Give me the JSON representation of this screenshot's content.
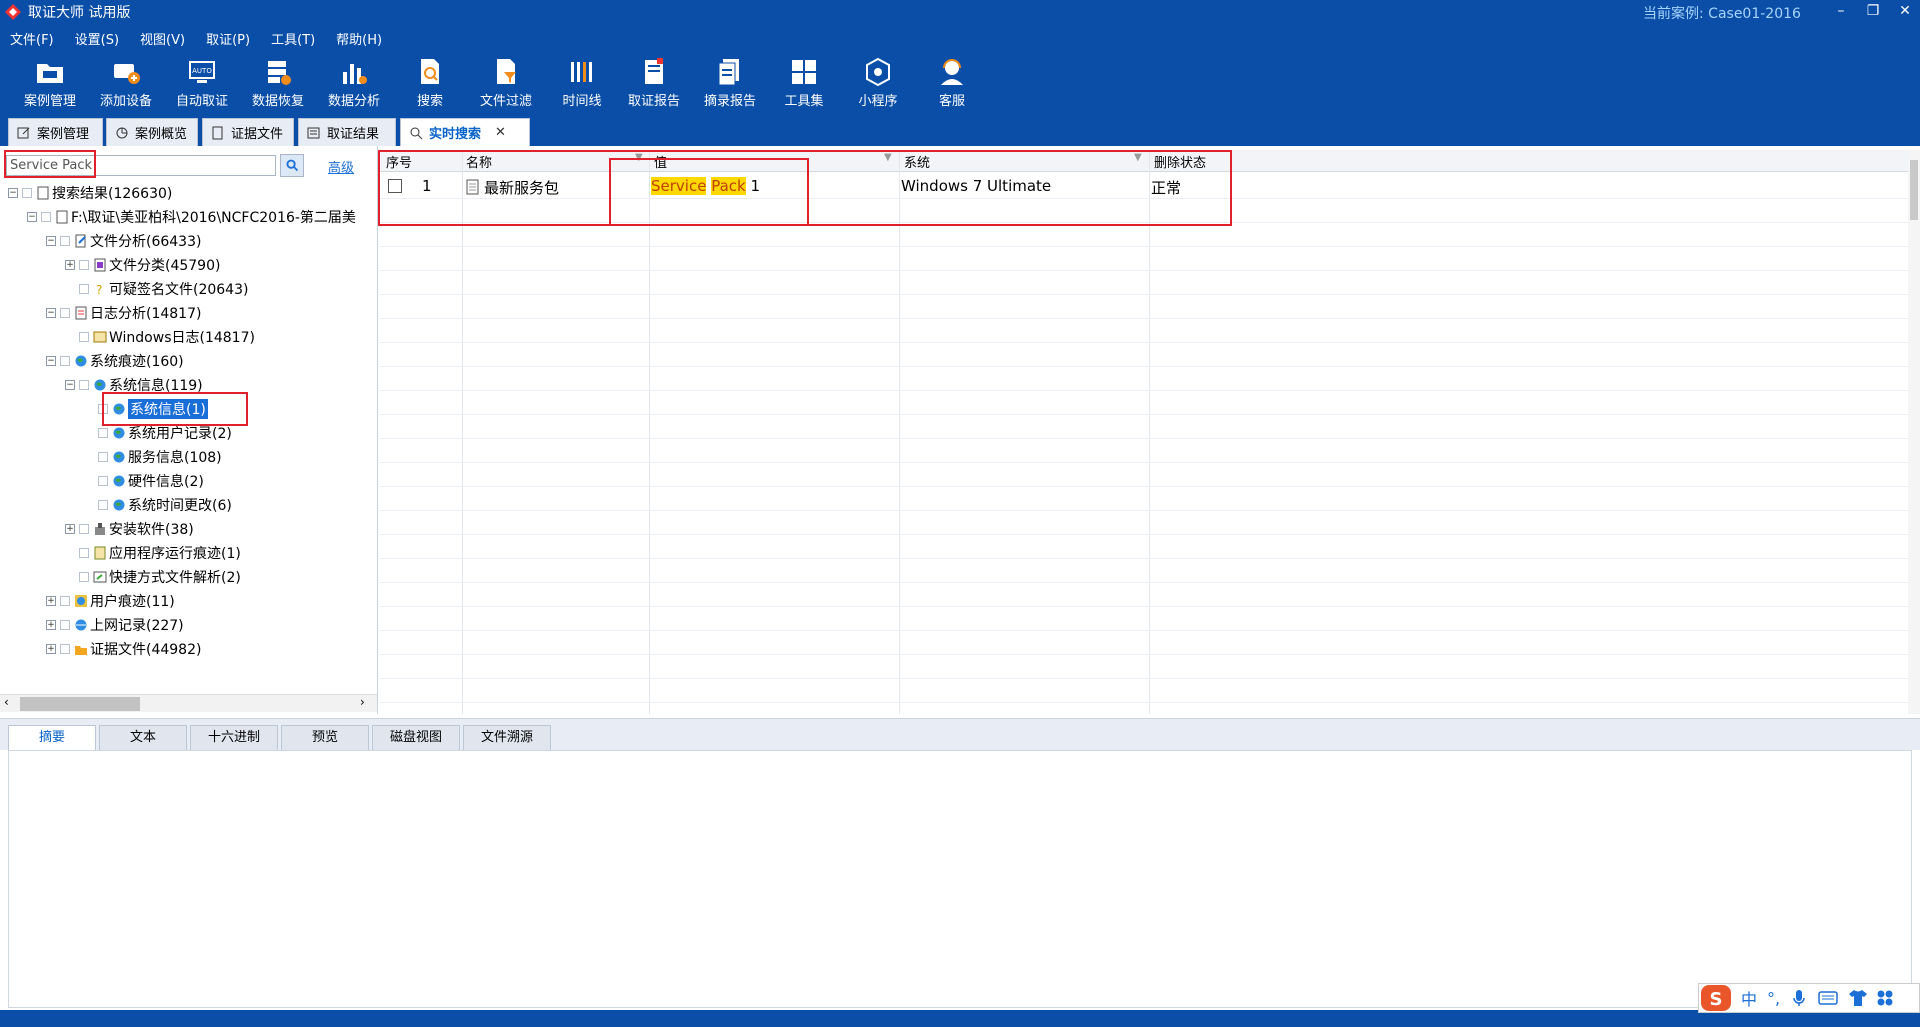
{
  "titlebar": {
    "app_title": "取证大师 试用版",
    "case_label": "当前案例:",
    "case_name": "Case01-2016"
  },
  "menu": [
    "文件(F)",
    "设置(S)",
    "视图(V)",
    "取证(P)",
    "工具(T)",
    "帮助(H)"
  ],
  "toolbar": [
    {
      "label": "案例管理",
      "icon": "folder-icon"
    },
    {
      "label": "添加设备",
      "icon": "add-device-icon"
    },
    {
      "label": "自动取证",
      "icon": "auto-icon"
    },
    {
      "label": "数据恢复",
      "icon": "data-recovery-icon"
    },
    {
      "label": "数据分析",
      "icon": "chart-icon"
    },
    {
      "label": "搜索",
      "icon": "search-doc-icon"
    },
    {
      "label": "文件过滤",
      "icon": "filter-icon"
    },
    {
      "label": "时间线",
      "icon": "timeline-icon"
    },
    {
      "label": "取证报告",
      "icon": "report-icon"
    },
    {
      "label": "摘录报告",
      "icon": "excerpt-icon"
    },
    {
      "label": "工具集",
      "icon": "grid-icon"
    },
    {
      "label": "小程序",
      "icon": "applet-icon"
    },
    {
      "label": "客服",
      "icon": "support-icon"
    }
  ],
  "tabs": [
    {
      "label": "案例管理"
    },
    {
      "label": "案例概览"
    },
    {
      "label": "证据文件"
    },
    {
      "label": "取证结果"
    },
    {
      "label": "实时搜索",
      "active": true,
      "close": "✕"
    }
  ],
  "search": {
    "value": "Service Pack",
    "advanced": "高级"
  },
  "tree": [
    {
      "label": "搜索结果(126630)"
    },
    {
      "label": "F:\\取证\\美亚柏科\\2016\\NCFC2016-第二届美"
    },
    {
      "label": "文件分析(66433)"
    },
    {
      "label": "文件分类(45790)"
    },
    {
      "label": "可疑签名文件(20643)"
    },
    {
      "label": "日志分析(14817)"
    },
    {
      "label": "Windows日志(14817)"
    },
    {
      "label": "系统痕迹(160)"
    },
    {
      "label": "系统信息(119)"
    },
    {
      "label": "系统信息(1)"
    },
    {
      "label": "系统用户记录(2)"
    },
    {
      "label": "服务信息(108)"
    },
    {
      "label": "硬件信息(2)"
    },
    {
      "label": "系统时间更改(6)"
    },
    {
      "label": "安装软件(38)"
    },
    {
      "label": "应用程序运行痕迹(1)"
    },
    {
      "label": "快捷方式文件解析(2)"
    },
    {
      "label": "用户痕迹(11)"
    },
    {
      "label": "上网记录(227)"
    },
    {
      "label": "证据文件(44982)"
    }
  ],
  "grid": {
    "columns": [
      "序号",
      "名称",
      "值",
      "系统",
      "删除状态"
    ],
    "rows": [
      {
        "index": "1",
        "name": "最新服务包",
        "value_hl1": "Service",
        "value_hl2": "Pack",
        "value_rest": " 1",
        "system": "Windows 7 Ultimate",
        "status": "正常"
      }
    ]
  },
  "bottom_tabs": [
    "摘要",
    "文本",
    "十六进制",
    "预览",
    "磁盘视图",
    "文件溯源"
  ],
  "ime": {
    "lang": "中",
    "punct": "°,"
  },
  "colors": {
    "titlebar": "#0a4ea7",
    "highlight": "#ffd800",
    "selection": "#1a6ed8",
    "annotation": "#e0202a"
  }
}
